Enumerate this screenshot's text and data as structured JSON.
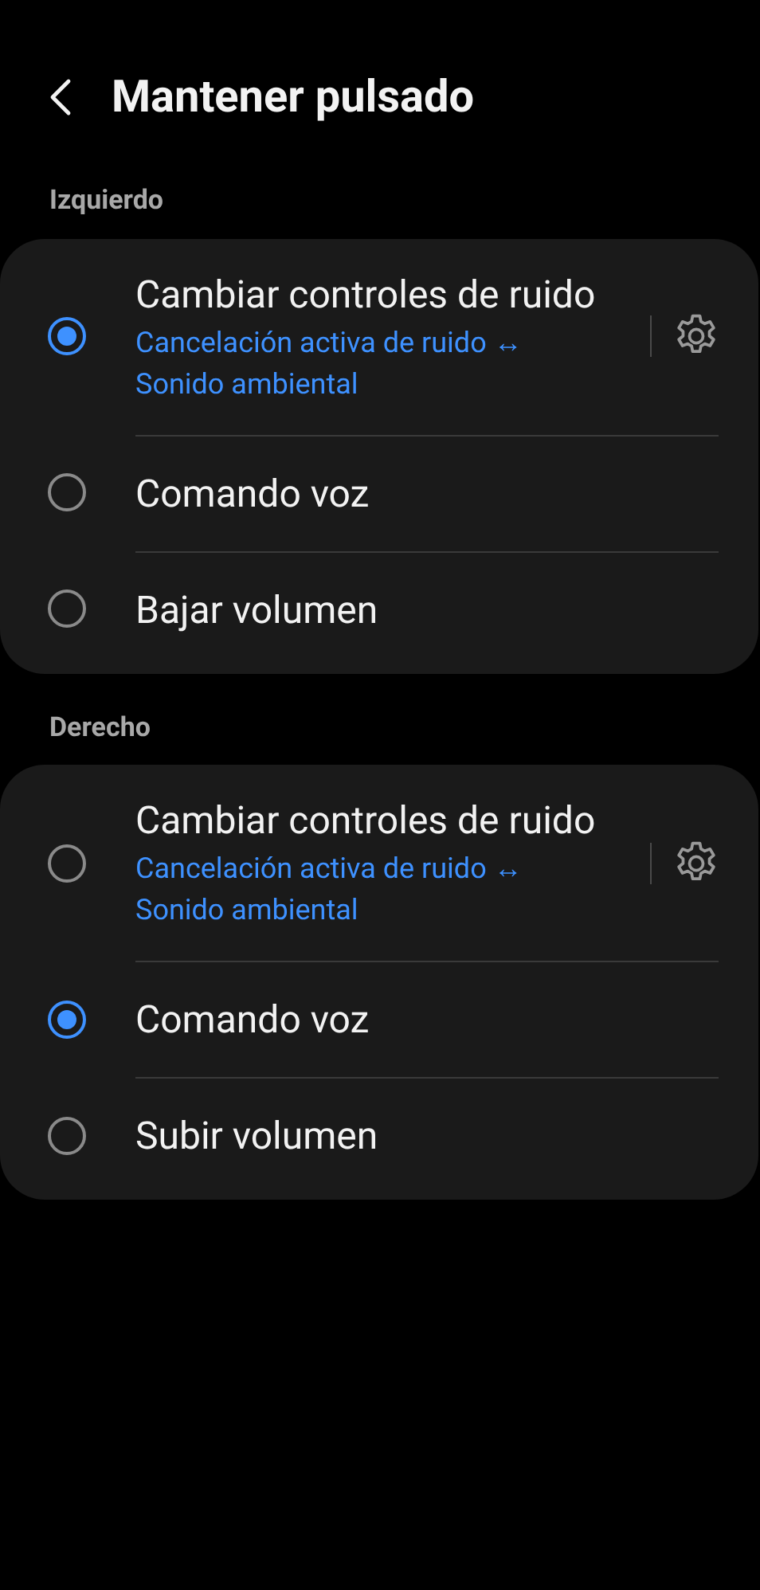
{
  "header": {
    "title": "Mantener pulsado"
  },
  "sections": [
    {
      "label": "Izquierdo",
      "options": [
        {
          "kind": "settings",
          "title": "Cambiar controles de ruido",
          "subtitle": "Cancelación activa de ruido ↔ Sonido ambiental",
          "selected": true
        },
        {
          "kind": "plain",
          "title": "Comando voz",
          "selected": false
        },
        {
          "kind": "plain",
          "title": "Bajar volumen",
          "selected": false
        }
      ]
    },
    {
      "label": "Derecho",
      "options": [
        {
          "kind": "settings",
          "title": "Cambiar controles de ruido",
          "subtitle": "Cancelación activa de ruido ↔ Sonido ambiental",
          "selected": false
        },
        {
          "kind": "plain",
          "title": "Comando voz",
          "selected": true
        },
        {
          "kind": "plain",
          "title": "Subir volumen",
          "selected": false
        }
      ]
    }
  ]
}
